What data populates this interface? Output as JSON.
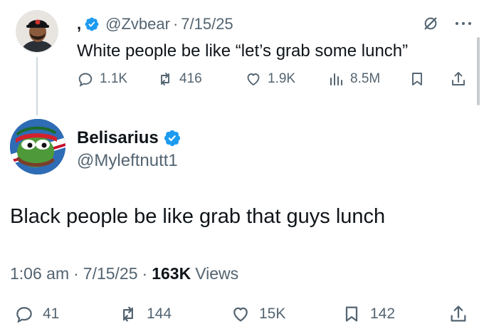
{
  "parent_tweet": {
    "display_name": ",",
    "handle": "@Zvbear",
    "separator": "·",
    "date": "7/15/25",
    "text": "White people be like “let’s grab some lunch”",
    "actions": {
      "replies": "1.1K",
      "reposts": "416",
      "likes": "1.9K",
      "views": "8.5M"
    }
  },
  "main_tweet": {
    "display_name": "Belisarius",
    "handle": "@Myleftnutt1",
    "text": "Black people be like grab that guys lunch",
    "time": "1:06 am",
    "separator": "·",
    "date": "7/15/25",
    "views_count": "163K",
    "views_label": "Views",
    "actions": {
      "replies": "41",
      "reposts": "144",
      "likes": "15K",
      "bookmarks": "142"
    }
  },
  "colors": {
    "text_primary": "#0f1419",
    "text_secondary": "#536471",
    "verified_blue": "#1d9bf0",
    "thread_line": "#cfd9de"
  },
  "icons": [
    "verified-badge-icon",
    "grok-icon",
    "more-icon",
    "reply-icon",
    "repost-icon",
    "like-icon",
    "views-icon",
    "bookmark-icon",
    "share-icon"
  ]
}
